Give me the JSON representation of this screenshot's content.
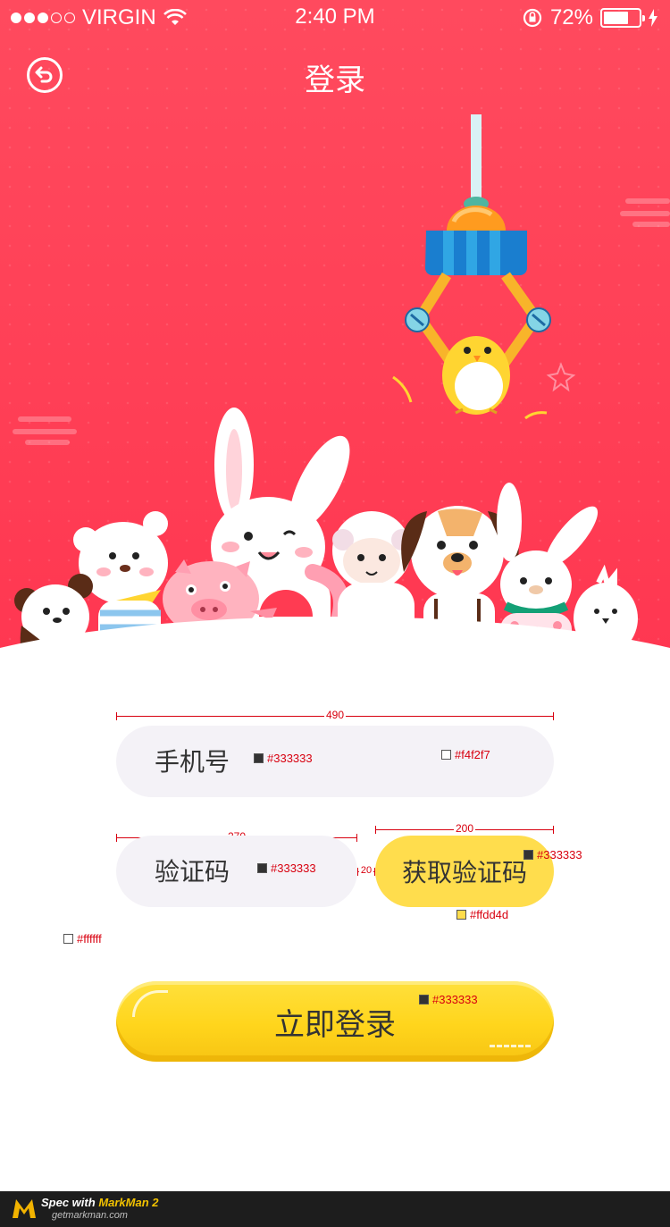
{
  "status_bar": {
    "carrier": "VIRGIN",
    "time": "2:40 PM",
    "battery": "72%",
    "battery_level": 0.72
  },
  "nav": {
    "title": "登录",
    "back_icon": "back-arrow-icon"
  },
  "form": {
    "phone": {
      "placeholder": "手机号",
      "width_label": "490"
    },
    "code": {
      "placeholder": "验证码",
      "width_label": "270"
    },
    "gap_label": "20",
    "get_code": {
      "label": "获取验证码",
      "width_label": "200"
    },
    "submit": {
      "label": "立即登录"
    }
  },
  "spec_annotations": {
    "phone_text_color": "#333333",
    "phone_bg_color": "#f4f2f7",
    "code_text_color": "#333333",
    "get_code_text_color": "#333333",
    "get_code_bg_color": "#ffdd4d",
    "page_bg_color": "#ffffff",
    "submit_text_color": "#333333"
  },
  "colors": {
    "hero": "#ff4158",
    "field_bg": "#f4f2f7",
    "accent_yellow": "#ffdd4d",
    "text": "#333333"
  },
  "footer": {
    "spec_with": "Spec with",
    "brand": "MarkMan 2",
    "site": "getmarkman.com"
  }
}
